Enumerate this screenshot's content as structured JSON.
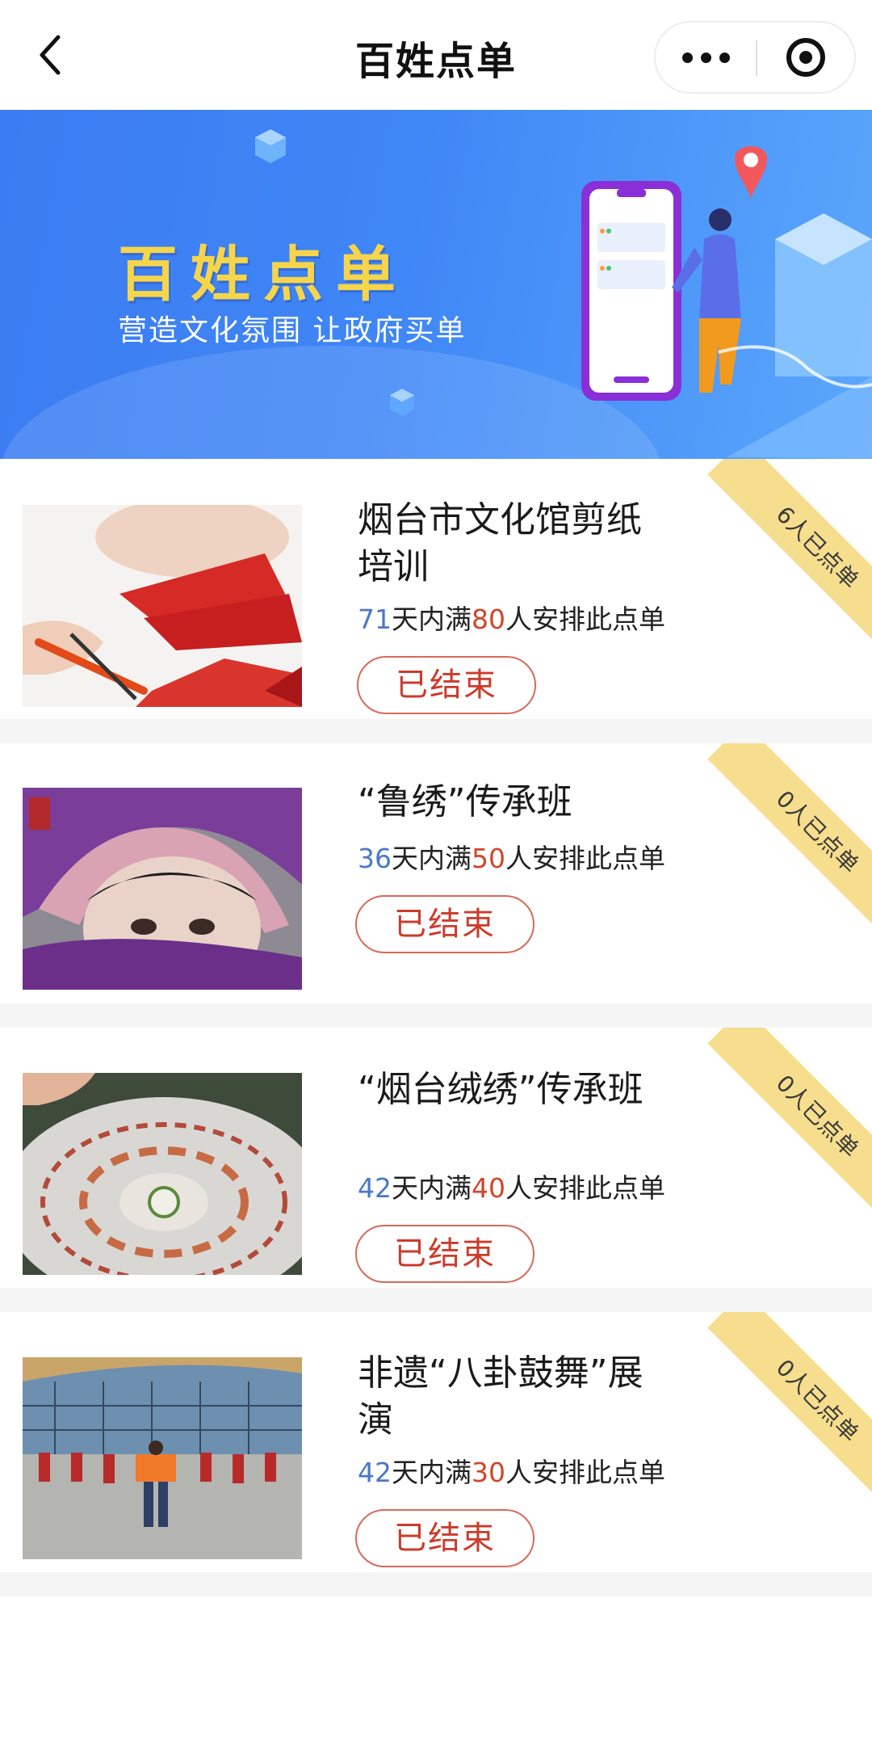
{
  "header": {
    "title": "百姓点单"
  },
  "banner": {
    "title": "百姓点单",
    "subtitle": "营造文化氛围 让政府买单",
    "colors": {
      "background": "#3f86f6",
      "title": "#f6d54a"
    }
  },
  "items": [
    {
      "title": "烟台市文化馆剪纸培训",
      "days": "71",
      "days_suffix": "天内满",
      "people": "80",
      "people_suffix": "人安排此点单",
      "status": "已结束",
      "ribbon": "6人已点单",
      "image": "papercut"
    },
    {
      "title": "“鲁绣”传承班",
      "days": "36",
      "days_suffix": "天内满",
      "people": "50",
      "people_suffix": "人安排此点单",
      "status": "已结束",
      "ribbon": "0人已点单",
      "image": "embroidery-portrait"
    },
    {
      "title": "“烟台绒绣”传承班",
      "days": "42",
      "days_suffix": "天内满",
      "people": "40",
      "people_suffix": "人安排此点单",
      "status": "已结束",
      "ribbon": "0人已点单",
      "image": "lace-embroidery"
    },
    {
      "title": "非遗“八卦鼓舞”展演",
      "days": "42",
      "days_suffix": "天内满",
      "people": "30",
      "people_suffix": "人安排此点单",
      "status": "已结束",
      "ribbon": "0人已点单",
      "image": "drum-dance"
    }
  ],
  "colors": {
    "number_blue": "#4a78c9",
    "number_red": "#d0462a",
    "ribbon": "#f6de8e",
    "button_border": "#d86a5a"
  }
}
